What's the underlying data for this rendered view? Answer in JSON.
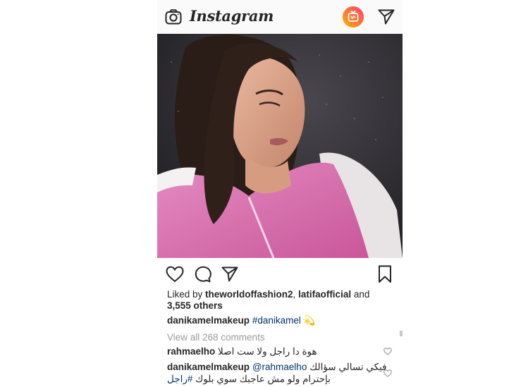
{
  "header": {
    "logo_text": "Instagram"
  },
  "post": {
    "liked_by_prefix": "Liked by ",
    "liked_user_1": "theworldoffashion2",
    "liked_sep": ", ",
    "liked_user_2": "latifaofficial",
    "liked_and": " and ",
    "liked_others": "3,555 others",
    "caption_user": "danikamelmakeup",
    "caption_tag": "#danikamel",
    "caption_emoji": "💫",
    "view_all": "View all 268 comments"
  },
  "comments": [
    {
      "user": "rahmaelho",
      "text": "هوة دا راجل ولا ست اصلا"
    },
    {
      "user": "danikamelmakeup",
      "mention": "@rahmaelho",
      "text": "فيكي تسالي سؤالك",
      "line2_text": "بإحترام ولو مش عاجبك سوي بلوك",
      "line2_tag": "#راجل"
    }
  ],
  "icons": {
    "camera": "camera-icon",
    "igtv": "igtv-icon",
    "direct": "direct-message-icon",
    "like": "heart-icon",
    "comment": "comment-icon",
    "share": "share-icon",
    "save": "bookmark-icon"
  },
  "colors": {
    "tag": "#003569",
    "muted": "#999999",
    "igtv_gradient_start": "#ffb000",
    "igtv_gradient_end": "#ff3c6e"
  }
}
